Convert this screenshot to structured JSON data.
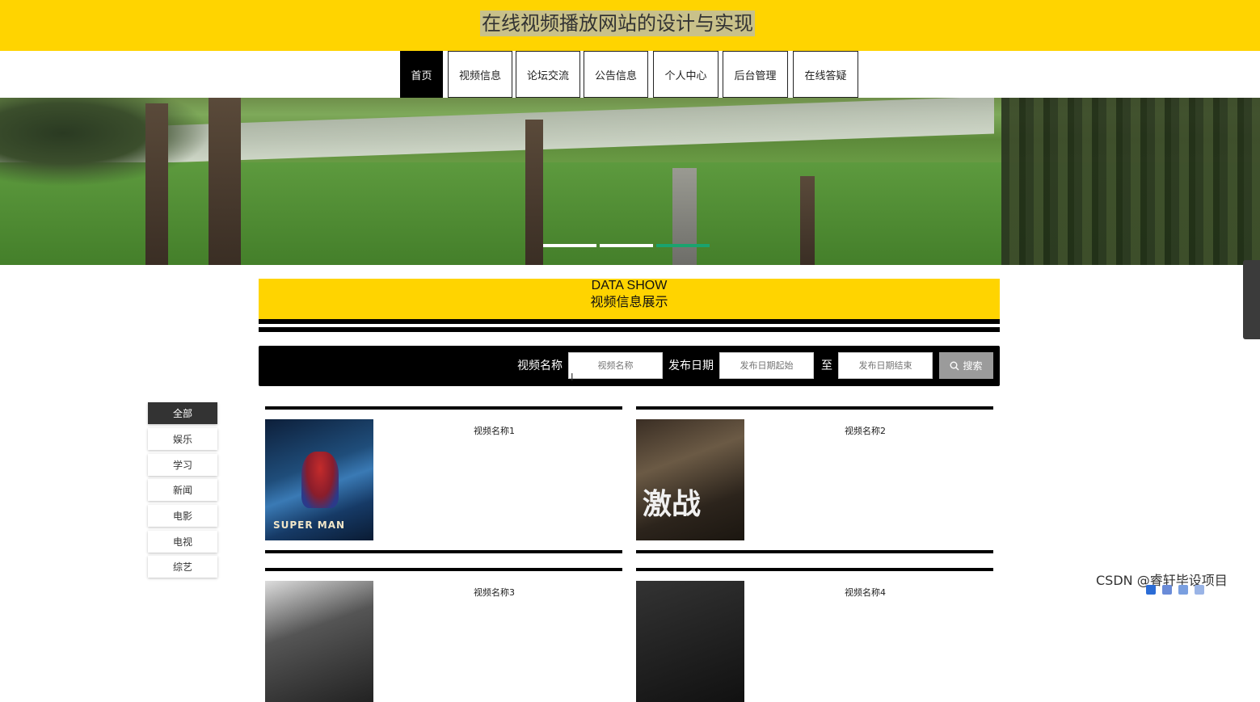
{
  "header": {
    "title": "在线视频播放网站的设计与实现"
  },
  "nav": {
    "items": [
      {
        "label": "首页",
        "active": true
      },
      {
        "label": "视频信息",
        "active": false
      },
      {
        "label": "论坛交流",
        "active": false
      },
      {
        "label": "公告信息",
        "active": false
      },
      {
        "label": "个人中心",
        "active": false
      },
      {
        "label": "后台管理",
        "active": false
      },
      {
        "label": "在线答疑",
        "active": false
      }
    ]
  },
  "banner": {
    "slides": 3,
    "active_slide": 3
  },
  "section": {
    "title_en": "DATA SHOW",
    "title_zh": "视频信息展示"
  },
  "search": {
    "name_label": "视频名称",
    "name_placeholder": "视频名称",
    "date_label": "发布日期",
    "date_start_placeholder": "发布日期起始",
    "date_sep": "至",
    "date_end_placeholder": "发布日期结束",
    "button_label": "搜索",
    "button_icon": "search-icon"
  },
  "categories": [
    {
      "label": "全部",
      "active": true
    },
    {
      "label": "娱乐",
      "active": false
    },
    {
      "label": "学习",
      "active": false
    },
    {
      "label": "新闻",
      "active": false
    },
    {
      "label": "电影",
      "active": false
    },
    {
      "label": "电视",
      "active": false
    },
    {
      "label": "综艺",
      "active": false
    }
  ],
  "videos": [
    {
      "name": "视频名称1",
      "poster_text": "SUPER MAN"
    },
    {
      "name": "视频名称2",
      "poster_text": "激战"
    },
    {
      "name": "视频名称3"
    },
    {
      "name": "视频名称4"
    }
  ],
  "watermark": "CSDN @睿轩毕设项目",
  "colors": {
    "accent": "#ffd400",
    "dark": "#000000",
    "active_dot": "#1aa36e"
  }
}
